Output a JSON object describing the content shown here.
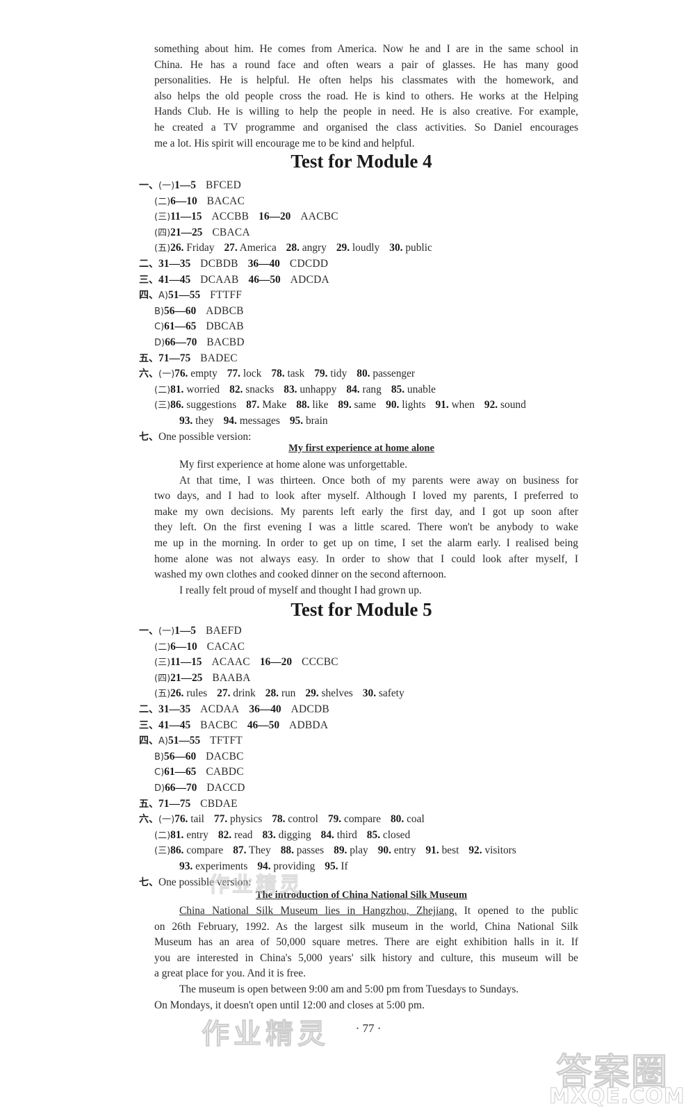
{
  "intro_paragraph": {
    "lines": [
      "something about him. He comes from America. Now he and I are in the same school in",
      "China. He has a round face and often wears a pair of glasses. He has many good",
      "personalities. He is helpful. He often helps his classmates with the homework, and",
      "also helps the old people cross the road. He is kind to others. He works at the Helping",
      "Hands Club. He is willing to help the people in need. He is also creative. For example,",
      "he created a TV programme and organised the class activities. So Daniel encourages",
      "me a lot. His spirit will encourage me to be kind and helpful."
    ]
  },
  "module4": {
    "title": "Test for Module 4",
    "rows": [
      {
        "sec": "一、",
        "sub": "(一)",
        "parts": [
          {
            "num": "1—5",
            "ans": "BFCED"
          }
        ]
      },
      {
        "sub": "(二)",
        "parts": [
          {
            "num": "6—10",
            "ans": "BACAC"
          }
        ]
      },
      {
        "sub": "(三)",
        "parts": [
          {
            "num": "11—15",
            "ans": "ACCBB"
          },
          {
            "num": "16—20",
            "ans": "AACBC"
          }
        ]
      },
      {
        "sub": "(四)",
        "parts": [
          {
            "num": "21—25",
            "ans": "CBACA"
          }
        ]
      },
      {
        "sub": "(五)",
        "items": [
          {
            "num": "26.",
            "word": "Friday"
          },
          {
            "num": "27.",
            "word": "America"
          },
          {
            "num": "28.",
            "word": "angry"
          },
          {
            "num": "29.",
            "word": "loudly"
          },
          {
            "num": "30.",
            "word": "public"
          }
        ]
      },
      {
        "sec": "二、",
        "parts": [
          {
            "num": "31—35",
            "ans": "DCBDB"
          },
          {
            "num": "36—40",
            "ans": "CDCDD"
          }
        ]
      },
      {
        "sec": "三、",
        "parts": [
          {
            "num": "41—45",
            "ans": "DCAAB"
          },
          {
            "num": "46—50",
            "ans": "ADCDA"
          }
        ]
      },
      {
        "sec": "四、",
        "sub": "A)",
        "parts": [
          {
            "num": "51—55",
            "ans": "FTTFF"
          }
        ]
      },
      {
        "sub": "B)",
        "parts": [
          {
            "num": "56—60",
            "ans": "ADBCB"
          }
        ]
      },
      {
        "sub": "C)",
        "parts": [
          {
            "num": "61—65",
            "ans": "DBCAB"
          }
        ]
      },
      {
        "sub": "D)",
        "parts": [
          {
            "num": "66—70",
            "ans": "BACBD"
          }
        ]
      },
      {
        "sec": "五、",
        "parts": [
          {
            "num": "71—75",
            "ans": "BADEC"
          }
        ]
      },
      {
        "sec": "六、",
        "sub": "(一)",
        "items": [
          {
            "num": "76.",
            "word": "empty"
          },
          {
            "num": "77.",
            "word": "lock"
          },
          {
            "num": "78.",
            "word": "task"
          },
          {
            "num": "79.",
            "word": "tidy"
          },
          {
            "num": "80.",
            "word": "passenger"
          }
        ]
      },
      {
        "sub": "(二)",
        "items": [
          {
            "num": "81.",
            "word": "worried"
          },
          {
            "num": "82.",
            "word": "snacks"
          },
          {
            "num": "83.",
            "word": "unhappy"
          },
          {
            "num": "84.",
            "word": "rang"
          },
          {
            "num": "85.",
            "word": "unable"
          }
        ]
      },
      {
        "sub": "(三)",
        "items": [
          {
            "num": "86.",
            "word": "suggestions"
          },
          {
            "num": "87.",
            "word": "Make"
          },
          {
            "num": "88.",
            "word": "like"
          },
          {
            "num": "89.",
            "word": "same"
          },
          {
            "num": "90.",
            "word": "lights"
          },
          {
            "num": "91.",
            "word": "when"
          },
          {
            "num": "92.",
            "word": "sound"
          }
        ]
      },
      {
        "cont": true,
        "items": [
          {
            "num": "93.",
            "word": "they"
          },
          {
            "num": "94.",
            "word": "messages"
          },
          {
            "num": "95.",
            "word": "brain"
          }
        ]
      },
      {
        "sec": "七、",
        "text": "One possible version:"
      }
    ],
    "essay": {
      "title": "My first experience at home alone",
      "paragraphs": [
        [
          "My first experience at home alone was unforgettable."
        ],
        [
          "At that time, I was thirteen. Once both of my parents were away on business for",
          "two days, and I had to look after myself. Although I loved my parents, I preferred to",
          "make my own decisions. My parents left early the first day, and I got up soon after",
          "they left. On the first evening I was a little scared. There won't be anybody to wake",
          "me up in the morning. In order to get up on time, I set the alarm early. I realised being",
          "home alone was not always easy. In order to show that I could look after myself, I",
          "washed my own clothes and cooked dinner on the second afternoon."
        ],
        [
          "I really felt proud of myself and thought I had grown up."
        ]
      ]
    }
  },
  "module5": {
    "title": "Test for Module 5",
    "rows": [
      {
        "sec": "一、",
        "sub": "(一)",
        "parts": [
          {
            "num": "1—5",
            "ans": "BAEFD"
          }
        ]
      },
      {
        "sub": "(二)",
        "parts": [
          {
            "num": "6—10",
            "ans": "CACAC"
          }
        ]
      },
      {
        "sub": "(三)",
        "parts": [
          {
            "num": "11—15",
            "ans": "ACAAC"
          },
          {
            "num": "16—20",
            "ans": "CCCBC"
          }
        ]
      },
      {
        "sub": "(四)",
        "parts": [
          {
            "num": "21—25",
            "ans": "BAABA"
          }
        ]
      },
      {
        "sub": "(五)",
        "items": [
          {
            "num": "26.",
            "word": "rules"
          },
          {
            "num": "27.",
            "word": "drink"
          },
          {
            "num": "28.",
            "word": "run"
          },
          {
            "num": "29.",
            "word": "shelves"
          },
          {
            "num": "30.",
            "word": "safety"
          }
        ]
      },
      {
        "sec": "二、",
        "parts": [
          {
            "num": "31—35",
            "ans": "ACDAA"
          },
          {
            "num": "36—40",
            "ans": "ADCDB"
          }
        ]
      },
      {
        "sec": "三、",
        "parts": [
          {
            "num": "41—45",
            "ans": "BACBC"
          },
          {
            "num": "46—50",
            "ans": "ADBDA"
          }
        ]
      },
      {
        "sec": "四、",
        "sub": "A)",
        "parts": [
          {
            "num": "51—55",
            "ans": "TFTFT"
          }
        ]
      },
      {
        "sub": "B)",
        "parts": [
          {
            "num": "56—60",
            "ans": "DACBC"
          }
        ]
      },
      {
        "sub": "C)",
        "parts": [
          {
            "num": "61—65",
            "ans": "CABDC"
          }
        ]
      },
      {
        "sub": "D)",
        "parts": [
          {
            "num": "66—70",
            "ans": "DACCD"
          }
        ]
      },
      {
        "sec": "五、",
        "parts": [
          {
            "num": "71—75",
            "ans": "CBDAE"
          }
        ]
      },
      {
        "sec": "六、",
        "sub": "(一)",
        "items": [
          {
            "num": "76.",
            "word": "tail"
          },
          {
            "num": "77.",
            "word": "physics"
          },
          {
            "num": "78.",
            "word": "control"
          },
          {
            "num": "79.",
            "word": "compare"
          },
          {
            "num": "80.",
            "word": "coal"
          }
        ]
      },
      {
        "sub": "(二)",
        "items": [
          {
            "num": "81.",
            "word": "entry"
          },
          {
            "num": "82.",
            "word": "read"
          },
          {
            "num": "83.",
            "word": "digging"
          },
          {
            "num": "84.",
            "word": "third"
          },
          {
            "num": "85.",
            "word": "closed"
          }
        ]
      },
      {
        "sub": "(三)",
        "items": [
          {
            "num": "86.",
            "word": "compare"
          },
          {
            "num": "87.",
            "word": "They"
          },
          {
            "num": "88.",
            "word": "passes"
          },
          {
            "num": "89.",
            "word": "play"
          },
          {
            "num": "90.",
            "word": "entry"
          },
          {
            "num": "91.",
            "word": "best"
          },
          {
            "num": "92.",
            "word": "visitors"
          }
        ]
      },
      {
        "cont": true,
        "items": [
          {
            "num": "93.",
            "word": "experiments"
          },
          {
            "num": "94.",
            "word": "providing"
          },
          {
            "num": "95.",
            "word": "If"
          }
        ]
      },
      {
        "sec": "七、",
        "text": "One possible version:"
      }
    ],
    "essay": {
      "title": "The introduction of China National Silk Museum",
      "first_line_underlined": "China National Silk Museum lies in Hangzhou, Zhejiang.",
      "first_line_rest": " It opened to the public",
      "lines": [
        "on 26th February, 1992. As the largest silk museum in the world, China National Silk",
        "Museum has an area of 50,000 square metres. There are eight exhibition halls in it. If",
        "you are interested in China's 5,000 years' silk history and culture, this museum will be",
        "a great place for you. And it is free."
      ],
      "para2": [
        "The museum is open between 9:00 am and 5:00 pm from Tuesdays to Sundays.",
        "On Mondays, it doesn't open until 12:00 and closes at 5:00 pm."
      ]
    }
  },
  "page_number": "· 77 ·",
  "watermarks": [
    "作业精灵",
    "答案圈",
    "MXQE.COM"
  ]
}
